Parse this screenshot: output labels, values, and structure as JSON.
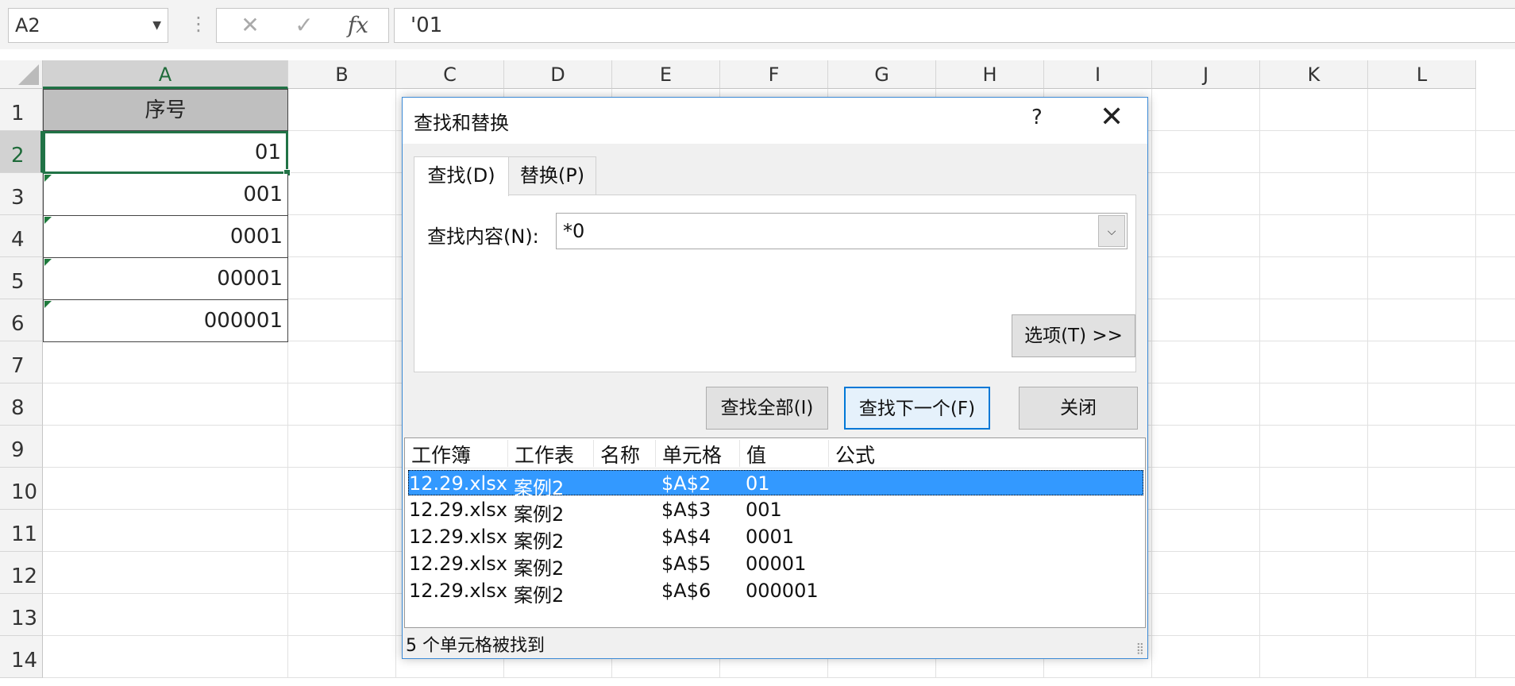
{
  "formula_bar": {
    "name_box": "A2",
    "cancel_icon": "✕",
    "enter_icon": "✓",
    "fx_label": "fx",
    "formula": "'01"
  },
  "sheet": {
    "columns": [
      "A",
      "B",
      "C",
      "D",
      "E",
      "F",
      "G",
      "H",
      "I",
      "J",
      "K",
      "L"
    ],
    "rows": [
      "1",
      "2",
      "3",
      "4",
      "5",
      "6",
      "7",
      "8",
      "9",
      "10",
      "11",
      "12",
      "13",
      "14"
    ],
    "cells": {
      "a1": "序号",
      "a2": "01",
      "a3": "001",
      "a4": "0001",
      "a5": "00001",
      "a6": "000001"
    }
  },
  "dialog": {
    "title": "查找和替换",
    "help": "?",
    "close": "✕",
    "tabs": {
      "find": "查找(D)",
      "replace": "替换(P)"
    },
    "find_label": "查找内容(N):",
    "find_value": "*0",
    "options_button": "选项(T) >>",
    "find_all_button": "查找全部(I)",
    "find_next_button": "查找下一个(F)",
    "close_button": "关闭",
    "results_headers": [
      "工作簿",
      "工作表",
      "名称",
      "单元格",
      "值",
      "公式"
    ],
    "results": [
      {
        "workbook": "12.29.xlsx",
        "sheet": "案例2",
        "name": "",
        "cell": "$A$2",
        "value": "01",
        "formula": ""
      },
      {
        "workbook": "12.29.xlsx",
        "sheet": "案例2",
        "name": "",
        "cell": "$A$3",
        "value": "001",
        "formula": ""
      },
      {
        "workbook": "12.29.xlsx",
        "sheet": "案例2",
        "name": "",
        "cell": "$A$4",
        "value": "0001",
        "formula": ""
      },
      {
        "workbook": "12.29.xlsx",
        "sheet": "案例2",
        "name": "",
        "cell": "$A$5",
        "value": "00001",
        "formula": ""
      },
      {
        "workbook": "12.29.xlsx",
        "sheet": "案例2",
        "name": "",
        "cell": "$A$6",
        "value": "000001",
        "formula": ""
      }
    ],
    "status": "5 个单元格被找到"
  },
  "colors": {
    "excel_green": "#217346",
    "selection_blue": "#3399ff",
    "dialog_border": "#3c8ad6"
  }
}
